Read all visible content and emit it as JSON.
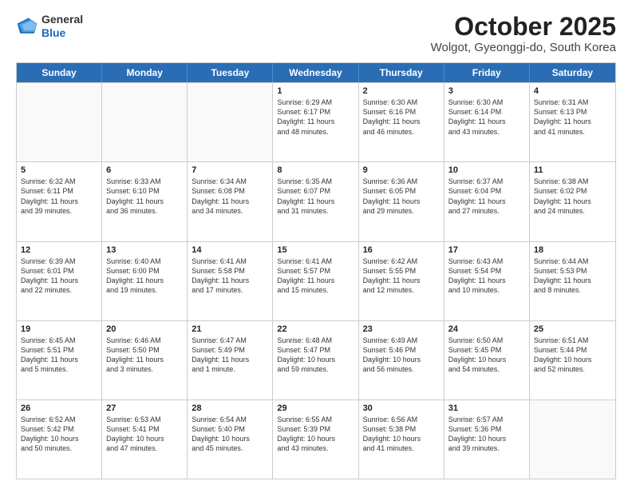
{
  "header": {
    "logo_line1": "General",
    "logo_line2": "Blue",
    "month_title": "October 2025",
    "location": "Wolgot, Gyeonggi-do, South Korea"
  },
  "weekdays": [
    "Sunday",
    "Monday",
    "Tuesday",
    "Wednesday",
    "Thursday",
    "Friday",
    "Saturday"
  ],
  "rows": [
    [
      {
        "day": "",
        "text": ""
      },
      {
        "day": "",
        "text": ""
      },
      {
        "day": "",
        "text": ""
      },
      {
        "day": "1",
        "text": "Sunrise: 6:29 AM\nSunset: 6:17 PM\nDaylight: 11 hours\nand 48 minutes."
      },
      {
        "day": "2",
        "text": "Sunrise: 6:30 AM\nSunset: 6:16 PM\nDaylight: 11 hours\nand 46 minutes."
      },
      {
        "day": "3",
        "text": "Sunrise: 6:30 AM\nSunset: 6:14 PM\nDaylight: 11 hours\nand 43 minutes."
      },
      {
        "day": "4",
        "text": "Sunrise: 6:31 AM\nSunset: 6:13 PM\nDaylight: 11 hours\nand 41 minutes."
      }
    ],
    [
      {
        "day": "5",
        "text": "Sunrise: 6:32 AM\nSunset: 6:11 PM\nDaylight: 11 hours\nand 39 minutes."
      },
      {
        "day": "6",
        "text": "Sunrise: 6:33 AM\nSunset: 6:10 PM\nDaylight: 11 hours\nand 36 minutes."
      },
      {
        "day": "7",
        "text": "Sunrise: 6:34 AM\nSunset: 6:08 PM\nDaylight: 11 hours\nand 34 minutes."
      },
      {
        "day": "8",
        "text": "Sunrise: 6:35 AM\nSunset: 6:07 PM\nDaylight: 11 hours\nand 31 minutes."
      },
      {
        "day": "9",
        "text": "Sunrise: 6:36 AM\nSunset: 6:05 PM\nDaylight: 11 hours\nand 29 minutes."
      },
      {
        "day": "10",
        "text": "Sunrise: 6:37 AM\nSunset: 6:04 PM\nDaylight: 11 hours\nand 27 minutes."
      },
      {
        "day": "11",
        "text": "Sunrise: 6:38 AM\nSunset: 6:02 PM\nDaylight: 11 hours\nand 24 minutes."
      }
    ],
    [
      {
        "day": "12",
        "text": "Sunrise: 6:39 AM\nSunset: 6:01 PM\nDaylight: 11 hours\nand 22 minutes."
      },
      {
        "day": "13",
        "text": "Sunrise: 6:40 AM\nSunset: 6:00 PM\nDaylight: 11 hours\nand 19 minutes."
      },
      {
        "day": "14",
        "text": "Sunrise: 6:41 AM\nSunset: 5:58 PM\nDaylight: 11 hours\nand 17 minutes."
      },
      {
        "day": "15",
        "text": "Sunrise: 6:41 AM\nSunset: 5:57 PM\nDaylight: 11 hours\nand 15 minutes."
      },
      {
        "day": "16",
        "text": "Sunrise: 6:42 AM\nSunset: 5:55 PM\nDaylight: 11 hours\nand 12 minutes."
      },
      {
        "day": "17",
        "text": "Sunrise: 6:43 AM\nSunset: 5:54 PM\nDaylight: 11 hours\nand 10 minutes."
      },
      {
        "day": "18",
        "text": "Sunrise: 6:44 AM\nSunset: 5:53 PM\nDaylight: 11 hours\nand 8 minutes."
      }
    ],
    [
      {
        "day": "19",
        "text": "Sunrise: 6:45 AM\nSunset: 5:51 PM\nDaylight: 11 hours\nand 5 minutes."
      },
      {
        "day": "20",
        "text": "Sunrise: 6:46 AM\nSunset: 5:50 PM\nDaylight: 11 hours\nand 3 minutes."
      },
      {
        "day": "21",
        "text": "Sunrise: 6:47 AM\nSunset: 5:49 PM\nDaylight: 11 hours\nand 1 minute."
      },
      {
        "day": "22",
        "text": "Sunrise: 6:48 AM\nSunset: 5:47 PM\nDaylight: 10 hours\nand 59 minutes."
      },
      {
        "day": "23",
        "text": "Sunrise: 6:49 AM\nSunset: 5:46 PM\nDaylight: 10 hours\nand 56 minutes."
      },
      {
        "day": "24",
        "text": "Sunrise: 6:50 AM\nSunset: 5:45 PM\nDaylight: 10 hours\nand 54 minutes."
      },
      {
        "day": "25",
        "text": "Sunrise: 6:51 AM\nSunset: 5:44 PM\nDaylight: 10 hours\nand 52 minutes."
      }
    ],
    [
      {
        "day": "26",
        "text": "Sunrise: 6:52 AM\nSunset: 5:42 PM\nDaylight: 10 hours\nand 50 minutes."
      },
      {
        "day": "27",
        "text": "Sunrise: 6:53 AM\nSunset: 5:41 PM\nDaylight: 10 hours\nand 47 minutes."
      },
      {
        "day": "28",
        "text": "Sunrise: 6:54 AM\nSunset: 5:40 PM\nDaylight: 10 hours\nand 45 minutes."
      },
      {
        "day": "29",
        "text": "Sunrise: 6:55 AM\nSunset: 5:39 PM\nDaylight: 10 hours\nand 43 minutes."
      },
      {
        "day": "30",
        "text": "Sunrise: 6:56 AM\nSunset: 5:38 PM\nDaylight: 10 hours\nand 41 minutes."
      },
      {
        "day": "31",
        "text": "Sunrise: 6:57 AM\nSunset: 5:36 PM\nDaylight: 10 hours\nand 39 minutes."
      },
      {
        "day": "",
        "text": ""
      }
    ]
  ]
}
